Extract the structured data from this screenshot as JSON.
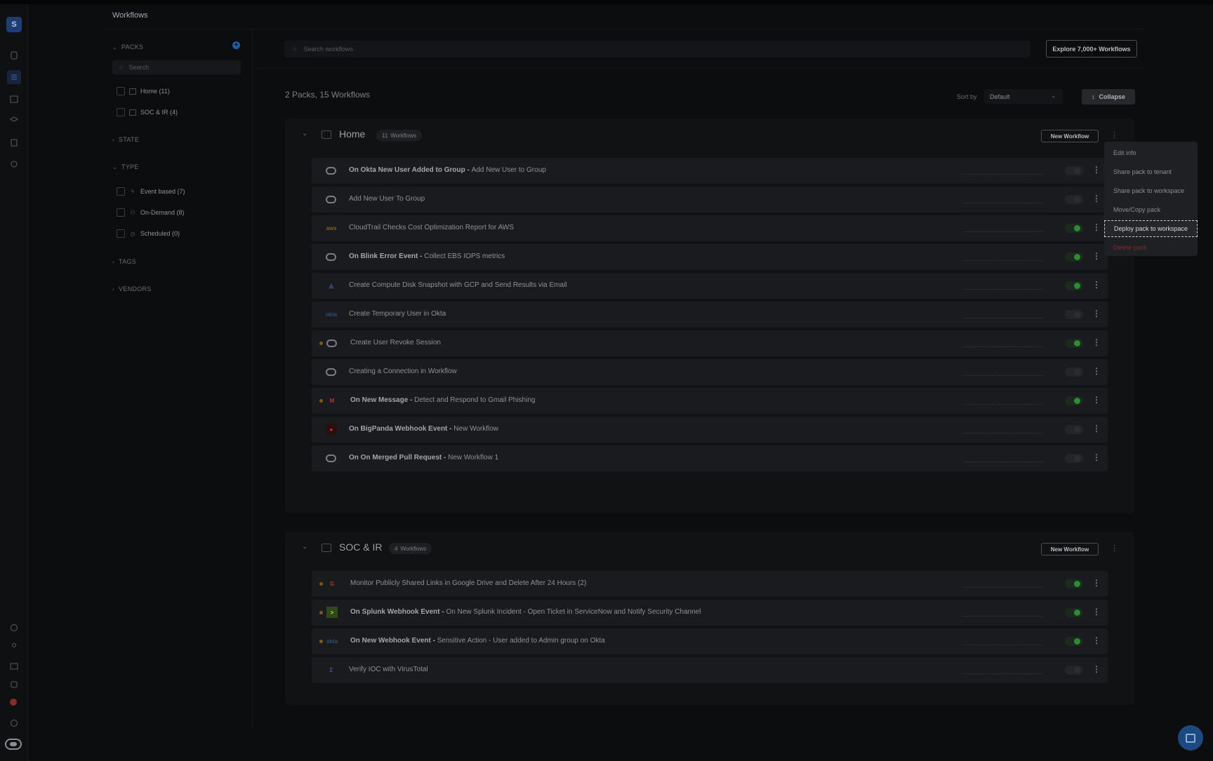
{
  "app": {
    "workspace_initial": "S",
    "page_title": "Workflows"
  },
  "sidebar": {
    "packs_label": "PACKS",
    "search_placeholder": "Search",
    "packs": [
      {
        "label": "Home (11)"
      },
      {
        "label": "SOC & IR (4)"
      }
    ],
    "state_label": "STATE",
    "type_label": "TYPE",
    "types": [
      {
        "label": "Event based (7)",
        "icon": "bolt-icon"
      },
      {
        "label": "On-Demand (8)",
        "icon": "user-icon"
      },
      {
        "label": "Scheduled (0)",
        "icon": "clock-icon"
      }
    ],
    "tags_label": "TAGS",
    "vendors_label": "VENDORS"
  },
  "toolbar": {
    "search_placeholder": "Search workflows",
    "explore_label": "Explore 7,000+ Workflows",
    "summary": "2 Packs, 15 Workflows",
    "sort_label": "Sort by",
    "sort_value": "Default",
    "collapse_label": "Collapse"
  },
  "packs": [
    {
      "name": "Home",
      "count": "11",
      "count_suffix": "Workflows",
      "new_label": "New Workflow",
      "rows": [
        {
          "icon": "blink-icon",
          "bold": "On Okta New User Added to Group - ",
          "text": "Add New User to Group",
          "on": false,
          "dot": false
        },
        {
          "icon": "blink-icon",
          "bold": "",
          "text": "Add New User To Group",
          "on": false,
          "dot": false
        },
        {
          "icon": "aws-icon",
          "bold": "",
          "text": "CloudTrail Checks Cost Optimization Report for AWS",
          "on": true,
          "dot": false
        },
        {
          "icon": "blink-icon",
          "bold": "On Blink Error Event - ",
          "text": "Collect EBS IOPS metrics",
          "on": true,
          "dot": false
        },
        {
          "icon": "gcp-icon",
          "bold": "",
          "text": "Create Compute Disk Snapshot with GCP and Send Results via Email",
          "on": true,
          "dot": false
        },
        {
          "icon": "okta-icon",
          "bold": "",
          "text": "Create Temporary User in Okta",
          "on": false,
          "dot": false
        },
        {
          "icon": "blink-icon",
          "bold": "",
          "text": "Create User Revoke Session",
          "on": true,
          "dot": true
        },
        {
          "icon": "blink-icon",
          "bold": "",
          "text": "Creating a Connection in Workflow",
          "on": false,
          "dot": false
        },
        {
          "icon": "gmail-icon",
          "bold": "On New Message - ",
          "text": "Detect and Respond to Gmail Phishing",
          "on": true,
          "dot": true
        },
        {
          "icon": "bigpanda-icon",
          "bold": "On BigPanda Webhook Event - ",
          "text": "New Workflow",
          "on": false,
          "dot": false
        },
        {
          "icon": "blink-icon",
          "bold": "On On Merged Pull Request - ",
          "text": "New Workflow 1",
          "on": false,
          "dot": false
        }
      ]
    },
    {
      "name": "SOC & IR",
      "count": "4",
      "count_suffix": "Workflows",
      "new_label": "New Workflow",
      "rows": [
        {
          "icon": "google-icon",
          "bold": "",
          "text": "Monitor Publicly Shared Links in Google Drive and Delete After 24 Hours (2)",
          "on": true,
          "dot": true
        },
        {
          "icon": "splunk-icon",
          "bold": "On Splunk Webhook Event - ",
          "text": "On New Splunk Incident - Open Ticket in ServiceNow and Notify Security Channel",
          "on": true,
          "dot": true
        },
        {
          "icon": "okta-icon",
          "bold": "On New Webhook Event - ",
          "text": "Sensitive Action - User added to Admin group on Okta",
          "on": true,
          "dot": true
        },
        {
          "icon": "virustotal-icon",
          "bold": "",
          "text": "Verify IOC with VirusTotal",
          "on": false,
          "dot": false
        }
      ]
    }
  ],
  "pack_menu": {
    "items": [
      "Edit info",
      "Share pack to tenant",
      "Share pack to workspace",
      "Move/Copy pack",
      "Deploy pack to workspace",
      "Delete pack"
    ]
  },
  "icon_glyphs": {
    "aws": "aws",
    "okta": "okta",
    "gmail": "M",
    "google": "G",
    "splunk": ">",
    "virustotal": "Σ"
  },
  "colors": {
    "accent": "#1b5ea8",
    "toggle_on": "#2d8a35",
    "danger": "#7a2e2e",
    "status_dot": "#7a5a1e"
  }
}
